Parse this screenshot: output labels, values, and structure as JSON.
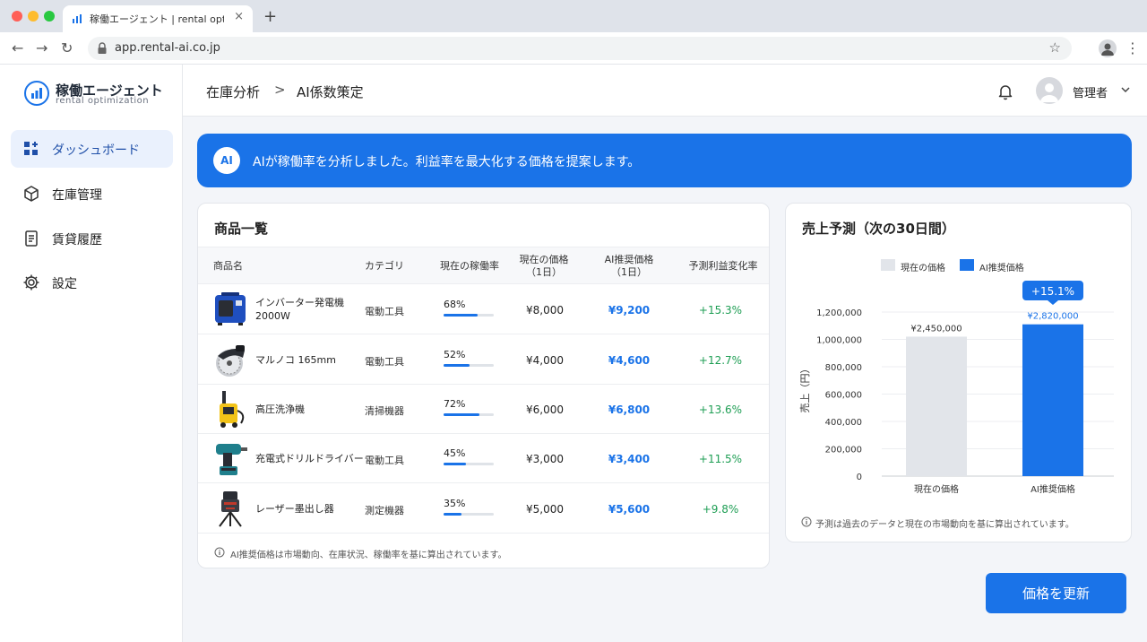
{
  "browser": {
    "tab_title": "稼働エージェント | rental optimization",
    "new_tab": "+",
    "tab_close": "×",
    "url": "app.rental-ai.co.jp"
  },
  "sidebar": {
    "logo_title": "稼働エージェント",
    "logo_sub": "rental optimization",
    "items": [
      {
        "label": "ダッシュボード",
        "icon": "dashboard-icon",
        "active": true
      },
      {
        "label": "在庫管理",
        "icon": "box-icon",
        "active": false
      },
      {
        "label": "賃貸履歴",
        "icon": "document-icon",
        "active": false
      },
      {
        "label": "設定",
        "icon": "gear-icon",
        "active": false
      }
    ]
  },
  "header": {
    "breadcrumb": [
      "在庫分析",
      "AI係数策定"
    ],
    "separator": ">",
    "user_name": "管理者"
  },
  "banner": {
    "badge": "AI",
    "text": "AIが稼働率を分析しました。利益率を最大化する価格を提案します。"
  },
  "products": {
    "title": "商品一覧",
    "columns": [
      {
        "l1": "商品名",
        "l2": ""
      },
      {
        "l1": "カテゴリ",
        "l2": ""
      },
      {
        "l1": "現在の稼働率",
        "l2": ""
      },
      {
        "l1": "現在の価格",
        "l2": "（1日）"
      },
      {
        "l1": "AI推奨価格",
        "l2": "（1日）"
      },
      {
        "l1": "予測利益変化率",
        "l2": ""
      }
    ],
    "rows": [
      {
        "name_l1": "インバーター発電機",
        "name_l2": "2000W",
        "category": "電動工具",
        "utilization_label": "68%",
        "utilization": 0.68,
        "price": "¥8,000",
        "ai_price": "¥9,200",
        "change": "+15.3%",
        "image": "generator"
      },
      {
        "name_l1": "マルノコ 165mm",
        "name_l2": "",
        "category": "電動工具",
        "utilization_label": "52%",
        "utilization": 0.52,
        "price": "¥4,000",
        "ai_price": "¥4,600",
        "change": "+12.7%",
        "image": "circular-saw"
      },
      {
        "name_l1": "高圧洗浄機",
        "name_l2": "",
        "category": "清掃機器",
        "utilization_label": "72%",
        "utilization": 0.72,
        "price": "¥6,000",
        "ai_price": "¥6,800",
        "change": "+13.6%",
        "image": "pressure-washer"
      },
      {
        "name_l1": "充電式ドリルドライバー",
        "name_l2": "",
        "category": "電動工具",
        "utilization_label": "45%",
        "utilization": 0.45,
        "price": "¥3,000",
        "ai_price": "¥3,400",
        "change": "+11.5%",
        "image": "drill"
      },
      {
        "name_l1": "レーザー墨出し器",
        "name_l2": "",
        "category": "測定機器",
        "utilization_label": "35%",
        "utilization": 0.35,
        "price": "¥5,000",
        "ai_price": "¥5,600",
        "change": "+9.8%",
        "image": "laser-level"
      }
    ],
    "note": "AI推奨価格は市場動向、在庫状況、稼働率を基に算出されています。"
  },
  "forecast": {
    "title": "売上予測（次の30日間）",
    "note": "予測は過去のデータと現在の市場動向を基に算出されています。",
    "badge": "+15.1%"
  },
  "chart_data": {
    "type": "bar",
    "categories": [
      "現在の価格",
      "AI推奨価格"
    ],
    "values": [
      1020000,
      1110000
    ],
    "value_labels": [
      "¥2,450,000",
      "¥2,820,000"
    ],
    "legend": [
      "現在の価格",
      "AI推奨価格"
    ],
    "legend_placement": "top",
    "colors": [
      "#e2e5ea",
      "#1a73e8"
    ],
    "ylabel": "売上（円）",
    "ylim": [
      0,
      1200000
    ],
    "yticks": [
      "0",
      "200,000",
      "400,000",
      "600,000",
      "800,000",
      "1,000,000",
      "1,200,000"
    ],
    "grid": true
  },
  "actions": {
    "update_label": "価格を更新"
  },
  "colors": {
    "accent": "#1a73e8",
    "positive": "#1e9e54",
    "active_nav_bg": "#eaf1fd"
  }
}
